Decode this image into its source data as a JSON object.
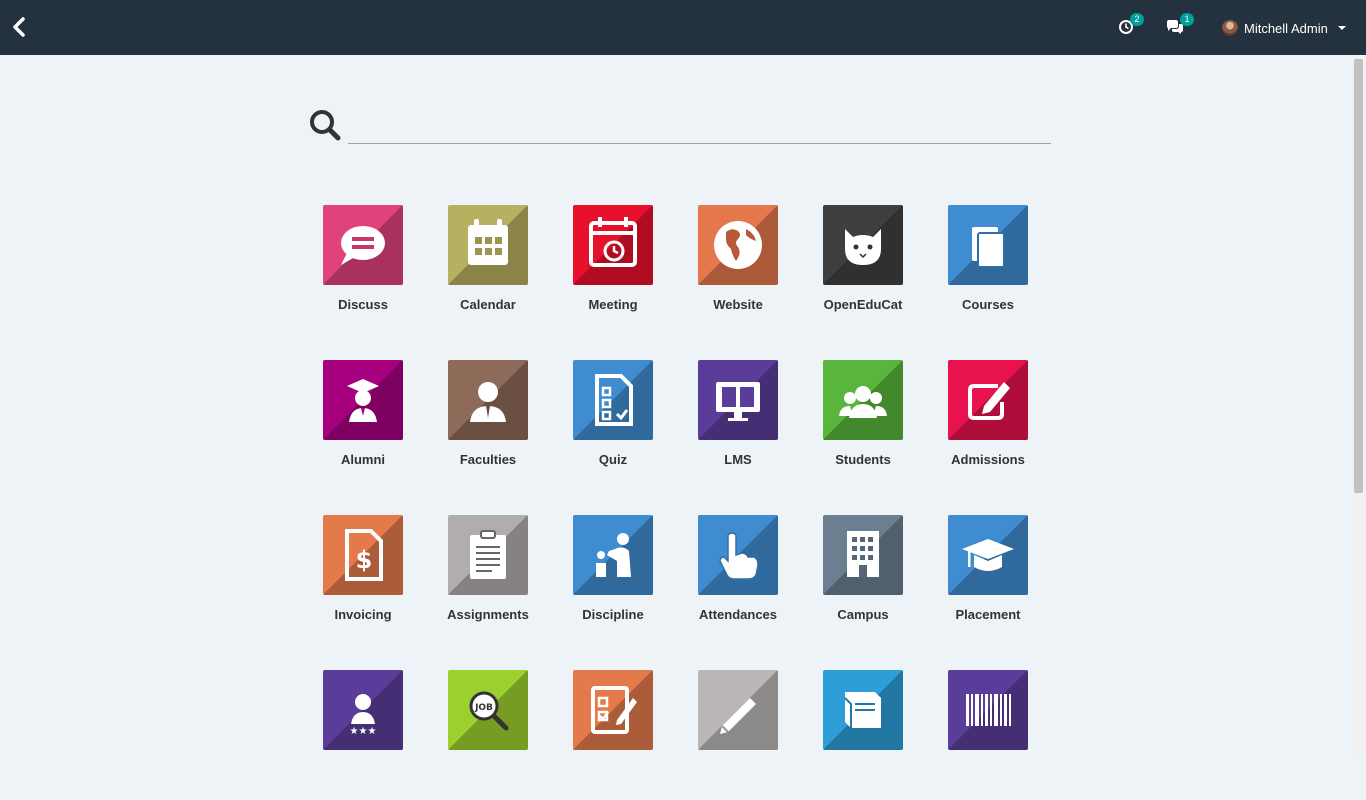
{
  "topbar": {
    "activity_count": "2",
    "messages_count": "1",
    "user_name": "Mitchell Admin"
  },
  "search": {
    "placeholder": ""
  },
  "apps": [
    {
      "label": "Discuss",
      "icon": "discuss-icon",
      "color": "#e0427c"
    },
    {
      "label": "Calendar",
      "icon": "calendar-icon",
      "color": "#b7b060"
    },
    {
      "label": "Meeting",
      "icon": "meeting-icon",
      "color": "#e8112d"
    },
    {
      "label": "Website",
      "icon": "globe-icon",
      "color": "#e4784c"
    },
    {
      "label": "OpenEduCat",
      "icon": "cat-logo-icon",
      "color": "#3f3f3f"
    },
    {
      "label": "Courses",
      "icon": "books-icon",
      "color": "#3f8cd0"
    },
    {
      "label": "Alumni",
      "icon": "graduate-icon",
      "color": "#a7007f"
    },
    {
      "label": "Faculties",
      "icon": "teacher-icon",
      "color": "#8e6a58"
    },
    {
      "label": "Quiz",
      "icon": "checklist-icon",
      "color": "#3f8cd0"
    },
    {
      "label": "LMS",
      "icon": "monitor-icon",
      "color": "#5a3d9a"
    },
    {
      "label": "Students",
      "icon": "users-icon",
      "color": "#5ab53c"
    },
    {
      "label": "Admissions",
      "icon": "edit-icon",
      "color": "#e8124f"
    },
    {
      "label": "Invoicing",
      "icon": "invoice-icon",
      "color": "#e47a4c"
    },
    {
      "label": "Assignments",
      "icon": "clipboard-icon",
      "color": "#b2adad"
    },
    {
      "label": "Discipline",
      "icon": "presenter-icon",
      "color": "#3f8cd0"
    },
    {
      "label": "Attendances",
      "icon": "hand-pointer-icon",
      "color": "#3f8cd0"
    },
    {
      "label": "Campus",
      "icon": "building-icon",
      "color": "#6b7f90"
    },
    {
      "label": "Placement",
      "icon": "mortarboard-icon",
      "color": "#3f8cd0"
    },
    {
      "label": "",
      "icon": "user-stars-icon",
      "color": "#5a3d9a"
    },
    {
      "label": "",
      "icon": "job-search-icon",
      "color": "#9ccf30"
    },
    {
      "label": "",
      "icon": "checklist-pen-icon",
      "color": "#e47a4c"
    },
    {
      "label": "",
      "icon": "pencil-icon",
      "color": "#bab6b6"
    },
    {
      "label": "",
      "icon": "book-icon",
      "color": "#2e9ed8"
    },
    {
      "label": "",
      "icon": "barcode-icon",
      "color": "#5a3d9a"
    }
  ]
}
